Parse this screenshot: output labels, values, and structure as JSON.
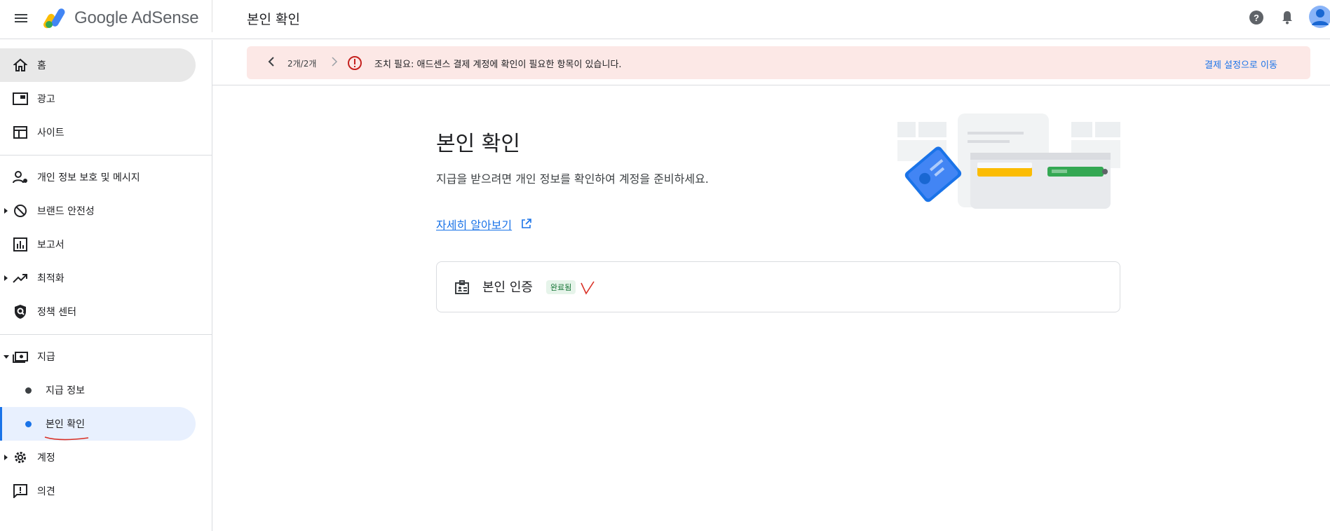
{
  "app": {
    "brand": "Google AdSense",
    "page_title": "본인 확인"
  },
  "header_icons": [
    "menu-icon",
    "help-icon",
    "notifications-icon",
    "account-avatar"
  ],
  "sidebar": {
    "items": [
      {
        "label": "홈",
        "icon": "home-icon"
      },
      {
        "label": "광고",
        "icon": "ads-icon"
      },
      {
        "label": "사이트",
        "icon": "sites-icon"
      },
      {
        "label": "개인 정보 보호 및 메시지",
        "icon": "privacy-icon"
      },
      {
        "label": "브랜드 안전성",
        "icon": "block-icon"
      },
      {
        "label": "보고서",
        "icon": "reports-icon"
      },
      {
        "label": "최적화",
        "icon": "trending-icon"
      },
      {
        "label": "정책 센터",
        "icon": "policy-shield-icon"
      },
      {
        "label": "지급",
        "icon": "payments-icon"
      },
      {
        "label": "지급 정보"
      },
      {
        "label": "본인 확인"
      },
      {
        "label": "계정",
        "icon": "gear-icon"
      },
      {
        "label": "의견",
        "icon": "feedback-icon"
      }
    ]
  },
  "banner": {
    "counter": "2개/2개",
    "message": "조치 필요: 애드센스 결제 계정에 확인이 필요한 항목이 있습니다.",
    "action_label": "결제 설정으로 이동",
    "color": "#fce8e6"
  },
  "main": {
    "title": "본인 확인",
    "description": "지급을 받으려면 개인 정보를 확인하여 계정을 준비하세요.",
    "learn_more": "자세히 알아보기",
    "card": {
      "title": "본인 인증",
      "status": "완료됨"
    }
  },
  "colors": {
    "accent": "#1a73e8",
    "active_sub_bg": "#e8f0fe",
    "home_active_bg": "#e8e8e8",
    "alert_red": "#c5221f",
    "success_bg": "#e6f4ea",
    "success_text": "#137333"
  }
}
